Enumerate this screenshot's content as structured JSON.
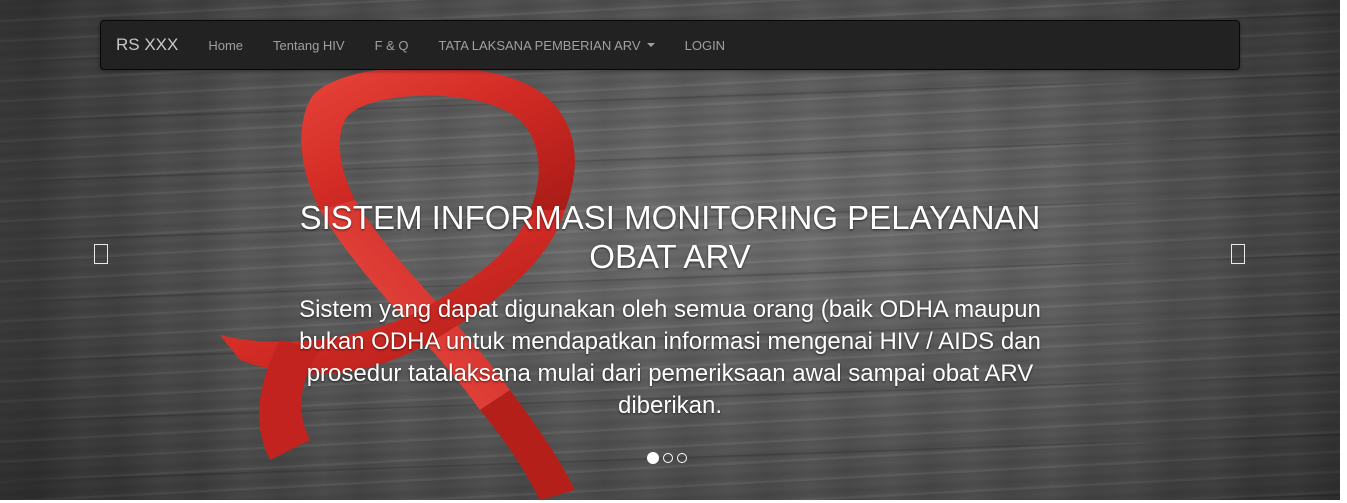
{
  "navbar": {
    "brand": "RS XXX",
    "items": [
      {
        "label": "Home"
      },
      {
        "label": "Tentang HIV"
      },
      {
        "label": "F & Q"
      },
      {
        "label": "TATA LAKSANA PEMBERIAN ARV",
        "dropdown": true
      },
      {
        "label": "LOGIN"
      }
    ]
  },
  "carousel": {
    "title": "SISTEM INFORMASI MONITORING PELAYANAN OBAT ARV",
    "description": "Sistem yang dapat digunakan oleh semua orang (baik ODHA maupun bukan ODHA untuk mendapatkan informasi mengenai HIV / AIDS dan prosedur tatalaksana mulai dari pemeriksaan awal sampai obat ARV diberikan.",
    "slide_count": 3,
    "active_slide": 1,
    "prev_icon": "chevron-left-icon",
    "next_icon": "chevron-right-icon"
  },
  "colors": {
    "navbar_bg": "#222222",
    "nav_text": "#a0a0a0",
    "ribbon": "#d8322b",
    "caption_text": "#ffffff"
  }
}
